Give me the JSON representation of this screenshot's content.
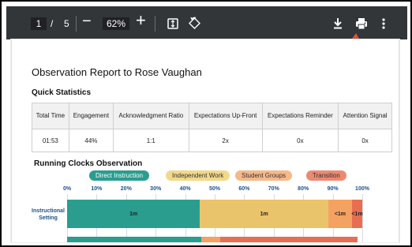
{
  "toolbar": {
    "page_current": "1",
    "page_sep": "/",
    "page_total": "5",
    "zoom_out": "−",
    "zoom_value": "62%",
    "zoom_in": "+"
  },
  "report": {
    "title": "Observation Report to Rose Vaughan",
    "quick_stats_heading": "Quick Statistics",
    "stats_headers": [
      "Total Time",
      "Engagement",
      "Acknowledgment Ratio",
      "Expectations Up-Front",
      "Expectations Reminder",
      "Attention Signal"
    ],
    "stats_values": [
      "01:53",
      "44%",
      "1:1",
      "2x",
      "0x",
      "0x"
    ],
    "running_heading": "Running Clocks Observation"
  },
  "legend": [
    {
      "label": "Direct Instruction",
      "color": "#2a9d8f"
    },
    {
      "label": "Independent Work",
      "color": "#e9c46a"
    },
    {
      "label": "Student Groups",
      "color": "#f4a261"
    },
    {
      "label": "Transition",
      "color": "#e76f51"
    }
  ],
  "axis_ticks": [
    "0%",
    "10%",
    "20%",
    "30%",
    "40%",
    "50%",
    "60%",
    "70%",
    "80%",
    "90%",
    "100%"
  ],
  "row_label": "Instructional Setting",
  "bar_segments": [
    {
      "label": "1m",
      "percent": 45,
      "color": "#2a9d8f"
    },
    {
      "label": "1m",
      "percent": 43.5,
      "color": "#e9c46a"
    },
    {
      "label": "<1m",
      "percent": 8,
      "color": "#f4a261"
    },
    {
      "label": "<1m",
      "percent": 3.5,
      "color": "#e76f51"
    }
  ],
  "colors": {
    "toolbar": "#323639",
    "annotation_arrow": "#e8522d"
  },
  "icons": [
    "download-icon",
    "print-icon",
    "more-vert-icon",
    "fit-page-icon",
    "rotate-icon"
  ]
}
